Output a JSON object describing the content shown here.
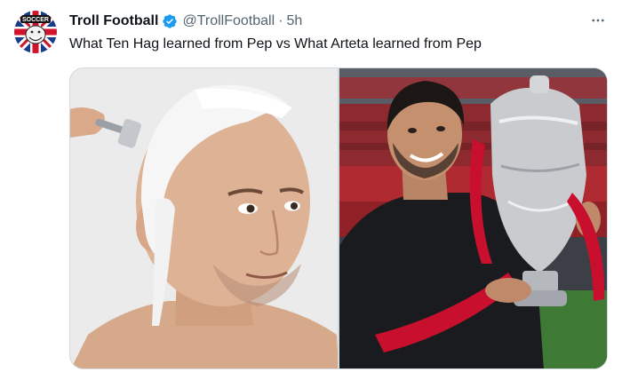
{
  "tweet": {
    "display_name": "Troll Football",
    "handle": "@TrollFootball",
    "separator": "·",
    "time": "5h",
    "text": "What Ten Hag learned from Pep vs What Arteta learned from Pep"
  },
  "avatar": {
    "banner_text": "SOCCER"
  },
  "icons": {
    "verified": "verified-badge-icon",
    "more": "more-options-icon"
  },
  "colors": {
    "verified_blue": "#1d9bf0",
    "text_primary": "#0f1419",
    "text_secondary": "#536471"
  },
  "media": {
    "count": 2
  }
}
